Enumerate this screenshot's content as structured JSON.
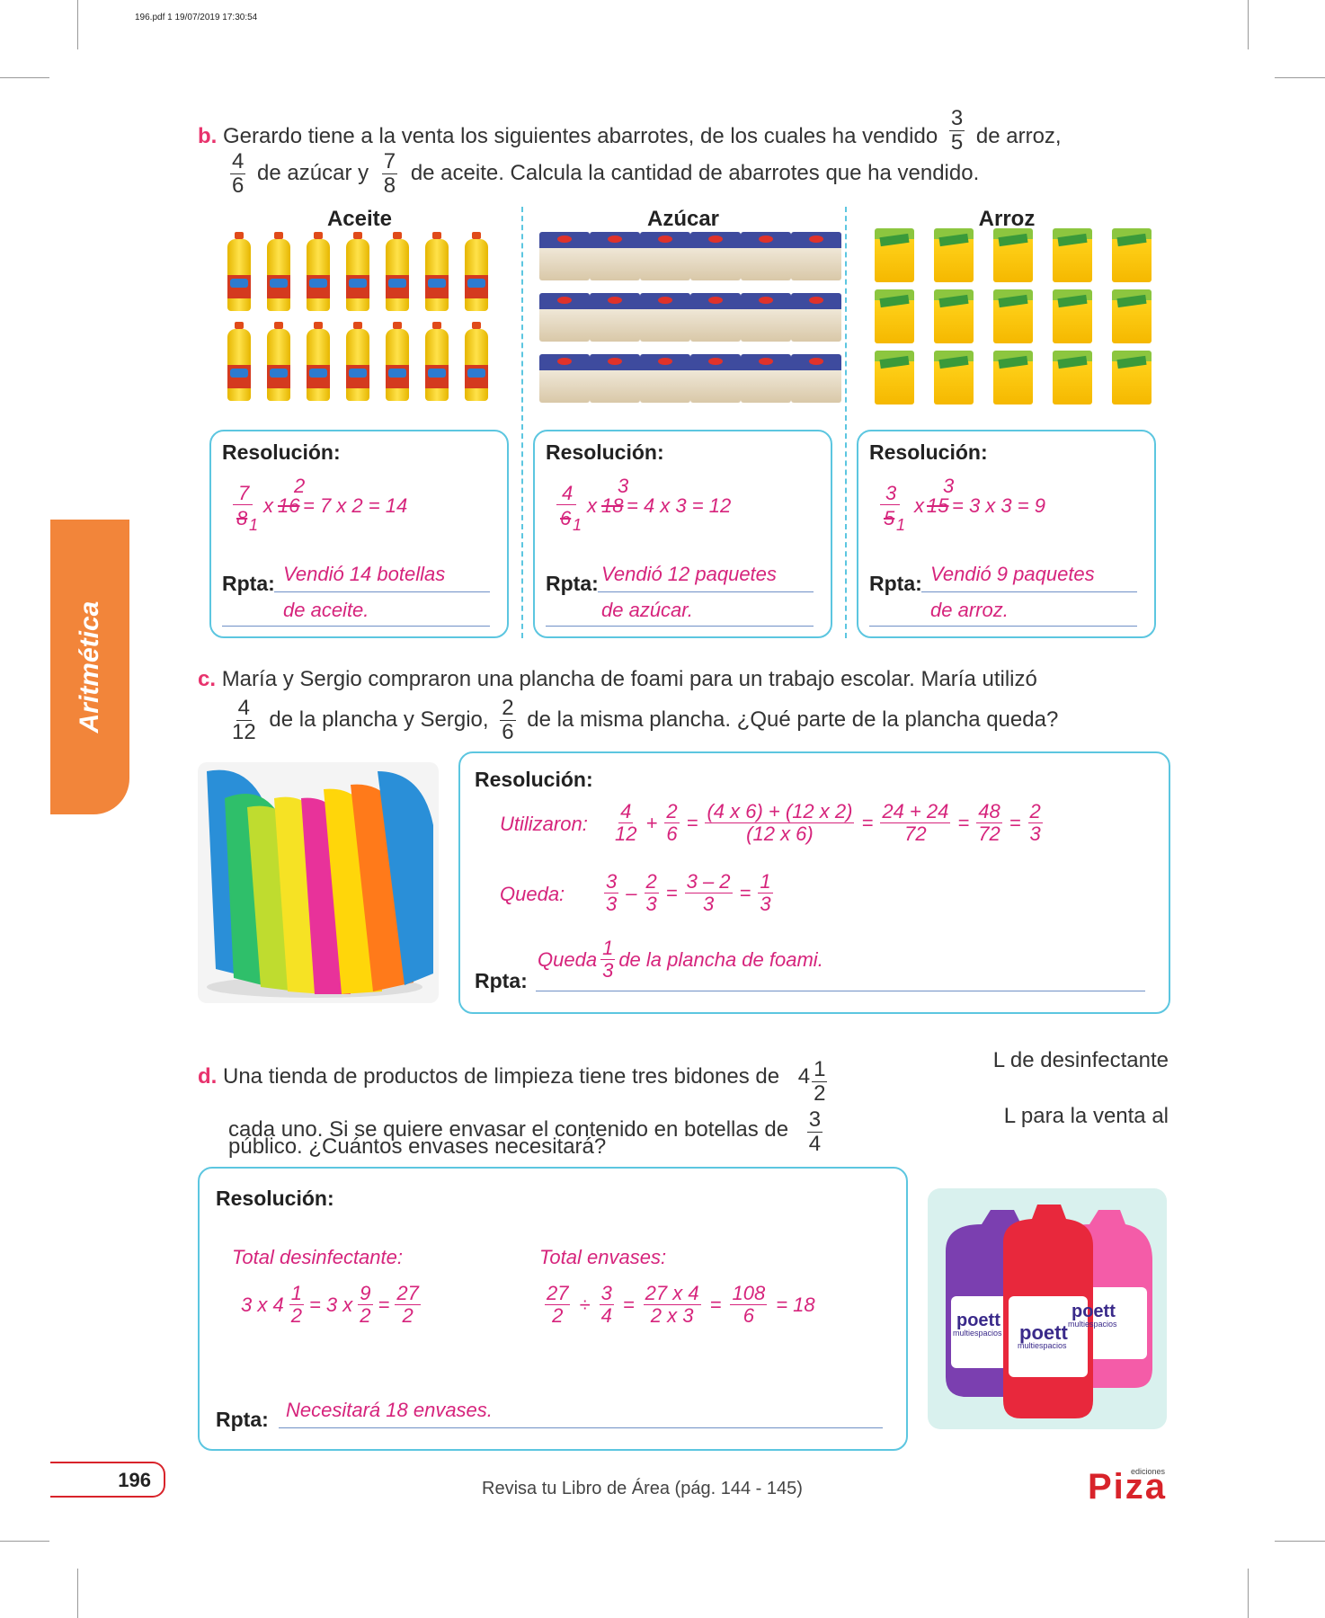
{
  "pdf_header": "196.pdf   1   19/07/2019   17:30:54",
  "side_tab": "Aritmética",
  "b": {
    "letter": "b.",
    "t1": "Gerardo tiene a la venta los siguientes abarrotes, de los cuales ha vendido",
    "f1n": "3",
    "f1d": "5",
    "t2": "de arroz,",
    "f2n": "4",
    "f2d": "6",
    "t3": "de azúcar y",
    "f3n": "7",
    "f3d": "8",
    "t4": "de aceite. Calcula la cantidad de abarrotes que ha vendido.",
    "titles": [
      "Aceite",
      "Azúcar",
      "Arroz"
    ],
    "boxes": [
      {
        "res": "Resolución:",
        "a": "7",
        "b": "8",
        "c": "1",
        "d": "16",
        "e": "2",
        "rest": "= 7 x 2 = 14",
        "rpta": "Rpta:",
        "ans1": "Vendió 14 botellas",
        "ans2": "de aceite."
      },
      {
        "res": "Resolución:",
        "a": "4",
        "b": "6",
        "c": "1",
        "d": "18",
        "e": "3",
        "rest": "= 4 x 3 = 12",
        "rpta": "Rpta:",
        "ans1": "Vendió 12 paquetes",
        "ans2": "de azúcar."
      },
      {
        "res": "Resolución:",
        "a": "3",
        "b": "5",
        "c": "1",
        "d": "15",
        "e": "3",
        "rest": "= 3 x 3 = 9",
        "rpta": "Rpta:",
        "ans1": "Vendió 9 paquetes",
        "ans2": "de arroz."
      }
    ],
    "x": "x"
  },
  "c": {
    "letter": "c.",
    "t1": "María y Sergio compraron una plancha de foami para un trabajo escolar. María utilizó",
    "f1n": "4",
    "f1d": "12",
    "t2": "de la plancha y Sergio,",
    "f2n": "2",
    "f2d": "6",
    "t3": "de la misma plancha. ¿Qué parte de la plancha queda?",
    "res": "Resolución:",
    "util": "Utilizaron:",
    "u": {
      "a_n": "4",
      "a_d": "12",
      "plus": "+",
      "b_n": "2",
      "b_d": "6",
      "eq": "=",
      "c_n": "(4 x 6) + (12 x 2)",
      "c_d": "(12 x 6)",
      "d_n": "24 + 24",
      "d_d": "72",
      "e_n": "48",
      "e_d": "72",
      "f_n": "2",
      "f_d": "3"
    },
    "queda": "Queda:",
    "qd": {
      "a_n": "3",
      "a_d": "3",
      "minus": "–",
      "b_n": "2",
      "b_d": "3",
      "c_n": "3 – 2",
      "c_d": "3",
      "d_n": "1",
      "d_d": "3"
    },
    "rpta": "Rpta:",
    "ans_a": "Queda",
    "ans_n": "1",
    "ans_d": "3",
    "ans_b": "de la plancha de foami."
  },
  "d": {
    "letter": "d.",
    "t1": "Una tienda de productos de limpieza tiene  tres bidones de",
    "m_whole": "4",
    "m_n": "1",
    "m_d": "2",
    "t2": "L de desinfectante",
    "t3": "cada uno. Si se quiere envasar el contenido en botellas de",
    "f_n": "3",
    "f_d": "4",
    "t4": "L para la venta al",
    "t5": "público. ¿Cuántos envases necesitará?",
    "res": "Resolución:",
    "h1": "Total desinfectante:",
    "h2": "Total envases:",
    "e1": {
      "a": "3 x 4",
      "a_n": "1",
      "a_d": "2",
      "b": "= 3 x",
      "b_n": "9",
      "b_d": "2",
      "eq": "=",
      "c_n": "27",
      "c_d": "2"
    },
    "e2": {
      "a_n": "27",
      "a_d": "2",
      "div": "÷",
      "b_n": "3",
      "b_d": "4",
      "eq": "=",
      "c_n": "27 x 4",
      "c_d": "2 x 3",
      "d_n": "108",
      "d_d": "6",
      "r": "= 18"
    },
    "rpta": "Rpta:",
    "ans": "Necesitará 18 envases.",
    "brand": "poett",
    "brand_sub": "multiespacios"
  },
  "footer": {
    "page": "196",
    "note": "Revisa tu Libro de Área (pág. 144 - 145)",
    "logo": "Piza",
    "logo_sup": "ediciones"
  },
  "colors": {
    "accent": "#e8336d",
    "answer": "#d6247c",
    "box": "#5cc6e0",
    "tab": "#f2853a"
  }
}
